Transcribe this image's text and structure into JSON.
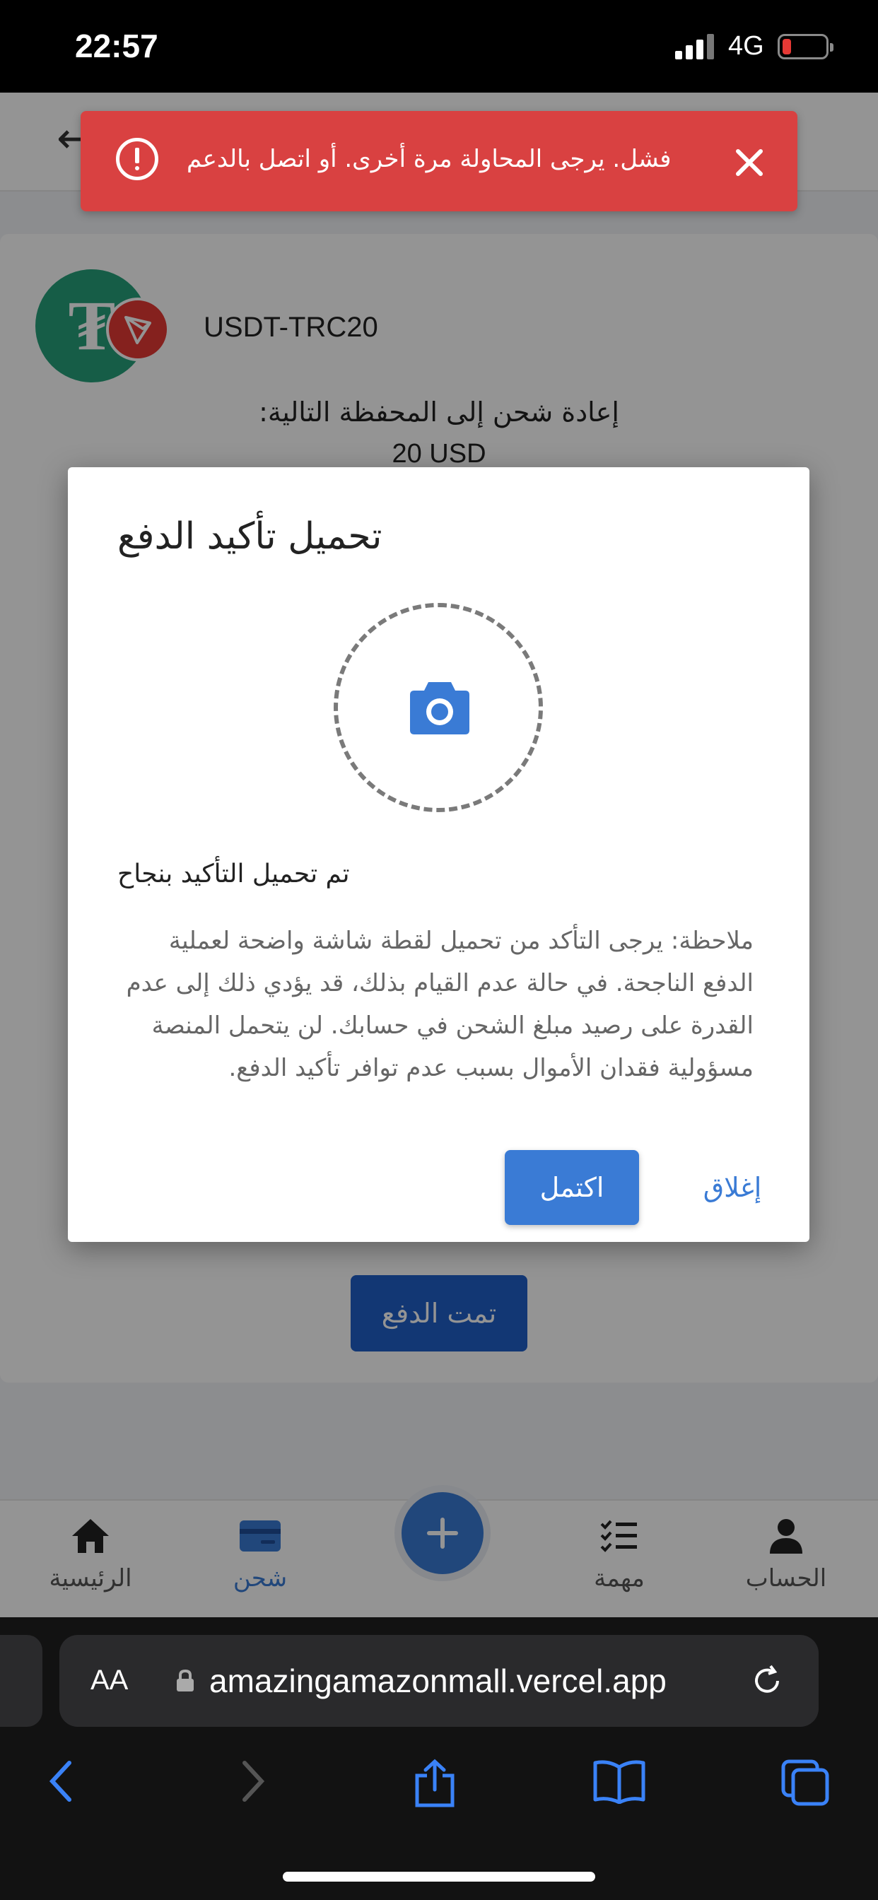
{
  "status_bar": {
    "time": "22:57",
    "network": "4G"
  },
  "page": {
    "coin_name": "USDT-TRC20",
    "recharge_label": "إعادة شحن إلى المحفظة التالية:",
    "recharge_amount": "20 USD",
    "paid_button": "تمت الدفع"
  },
  "toast": {
    "message": "فشل. يرجى المحاولة مرة أخرى. أو اتصل بالدعم"
  },
  "dialog": {
    "title": "تحميل تأكيد الدفع",
    "success_text": "تم تحميل التأكيد بنجاح",
    "note": "ملاحظة: يرجى التأكد من تحميل لقطة شاشة واضحة لعملية الدفع الناجحة. في حالة عدم القيام بذلك، قد يؤدي ذلك إلى عدم القدرة على رصيد مبلغ الشحن في حسابك. لن يتحمل المنصة مسؤولية فقدان الأموال بسبب عدم توافر تأكيد الدفع.",
    "confirm_button": "اكتمل",
    "close_button": "إغلاق"
  },
  "bottom_nav": {
    "items": [
      {
        "label": "الرئيسية",
        "icon": "home-icon"
      },
      {
        "label": "شحن",
        "icon": "card-icon",
        "active": true
      },
      {
        "label": "",
        "icon": "plus-icon"
      },
      {
        "label": "مهمة",
        "icon": "tasks-icon"
      },
      {
        "label": "الحساب",
        "icon": "person-icon"
      }
    ]
  },
  "browser": {
    "url": "amazingamazonmall.vercel.app",
    "text_size_label": "AA"
  },
  "colors": {
    "accent": "#3a7bd5",
    "error": "#d94141",
    "tether": "#26a17b",
    "tron": "#e53935"
  }
}
